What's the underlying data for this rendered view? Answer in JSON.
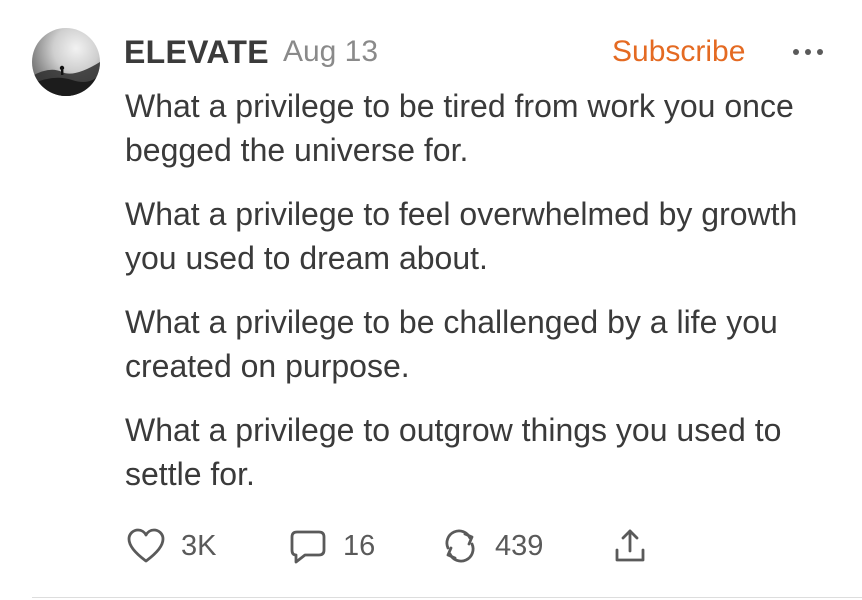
{
  "post": {
    "author": "ELEVATE",
    "date": "Aug 13",
    "subscribe_label": "Subscribe",
    "paragraphs": [
      "What a privilege to be tired from work you once begged the universe for.",
      "What a privilege to feel overwhelmed by growth you used to dream about.",
      "What a privilege to be challenged by a life you created on purpose.",
      "What a privilege to outgrow things you used to settle for."
    ]
  },
  "actions": {
    "likes": "3K",
    "comments": "16",
    "restacks": "439"
  },
  "icons": {
    "like": "heart-icon",
    "comment": "comment-bubble-icon",
    "restack": "restack-arrows-icon",
    "share": "share-upload-icon",
    "more": "more-dots-icon"
  },
  "colors": {
    "accent": "#e46a22",
    "text": "#3a3a3a",
    "muted": "#8a8a8a"
  }
}
